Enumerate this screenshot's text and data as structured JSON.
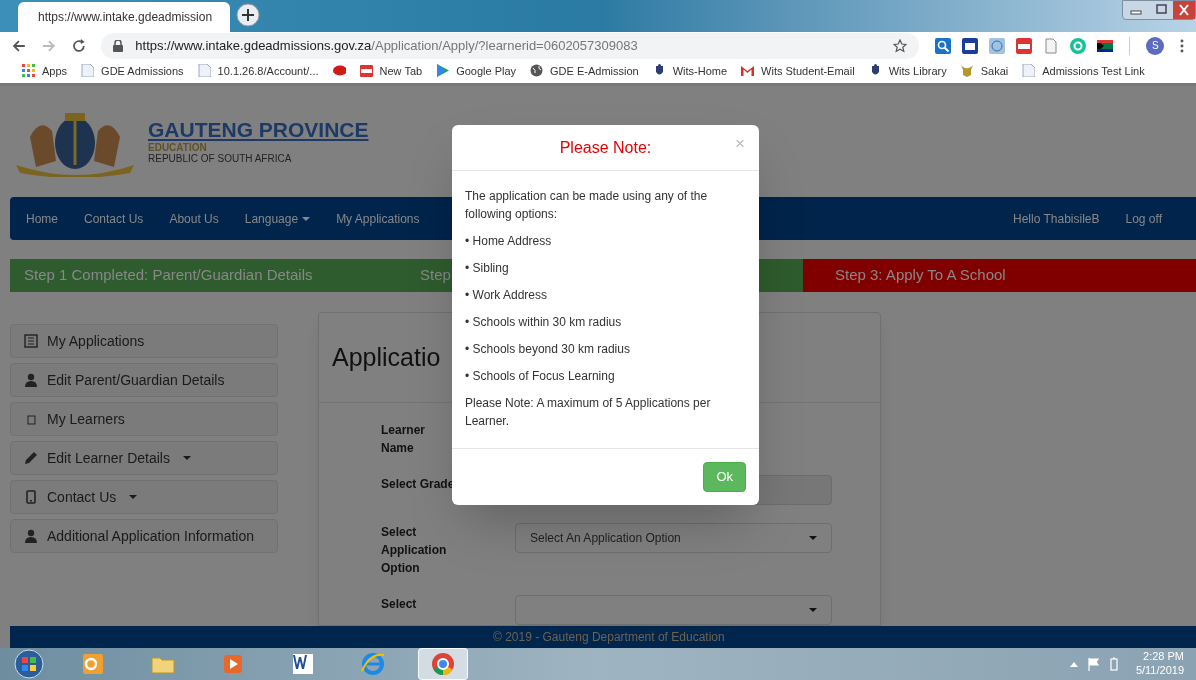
{
  "browser": {
    "tab": {
      "title": "https://www.intake.gdeadmission"
    },
    "url": {
      "host": "https://www.intake.gdeadmissions.gov.za",
      "path": "/Application/Apply/?learnerid=0602057309083"
    },
    "profile": "S",
    "bookmarks": [
      {
        "label": "Apps",
        "kind": "apps"
      },
      {
        "label": "GDE Admissions",
        "kind": "page"
      },
      {
        "label": "10.1.26.8/Account/...",
        "kind": "page"
      },
      {
        "kind": "ask"
      },
      {
        "label": "New Tab",
        "kind": "pdf"
      },
      {
        "label": "Google Play",
        "kind": "play"
      },
      {
        "label": "GDE E-Admission",
        "kind": "globe"
      },
      {
        "label": "Wits-Home",
        "kind": "crest"
      },
      {
        "label": "Wits Student-Email",
        "kind": "gmail"
      },
      {
        "label": "Wits Library",
        "kind": "crest"
      },
      {
        "label": "Sakai",
        "kind": "bull"
      },
      {
        "label": "Admissions Test Link",
        "kind": "page"
      }
    ]
  },
  "header": {
    "title": "GAUTENG PROVINCE",
    "subtitle": "EDUCATION",
    "country": "REPUBLIC OF SOUTH AFRICA"
  },
  "nav": {
    "items": [
      {
        "label": "Home",
        "dropdown": false
      },
      {
        "label": "Contact Us",
        "dropdown": false
      },
      {
        "label": "About Us",
        "dropdown": false
      },
      {
        "label": "Language",
        "dropdown": true
      },
      {
        "label": "My Applications",
        "dropdown": false
      }
    ],
    "right": [
      {
        "label": "Hello ThabisileB"
      },
      {
        "label": "Log off"
      }
    ]
  },
  "steps": [
    {
      "label": "Step 1 Completed: Parent/Guardian Details",
      "completed": true
    },
    {
      "label": "Step",
      "completed": true
    },
    {
      "label": "Step 3: Apply To A School",
      "completed": false
    }
  ],
  "sidebar": {
    "items": [
      {
        "label": "My Applications",
        "kind": "list",
        "dropdown": false
      },
      {
        "label": "Edit Parent/Guardian Details",
        "kind": "person",
        "dropdown": false
      },
      {
        "label": "My Learners",
        "kind": "square",
        "dropdown": false
      },
      {
        "label": "Edit Learner Details",
        "kind": "pencil",
        "dropdown": true
      },
      {
        "label": "Contact Us",
        "kind": "phone",
        "dropdown": true
      },
      {
        "label": "Additional Application Information",
        "kind": "person",
        "dropdown": false
      }
    ]
  },
  "panel": {
    "title": "Applicatio",
    "fields": [
      {
        "label": "Learner Name",
        "kind": "hidden"
      },
      {
        "label": "Select Grade",
        "kind": "readonly"
      },
      {
        "label": "Select Application Option",
        "kind": "select",
        "value": "Select An Application Option"
      },
      {
        "label": "Select",
        "kind": "select"
      }
    ]
  },
  "modal": {
    "title": "Please Note:",
    "close": "×",
    "intro": "The application can be made using any of the following options:",
    "options": [
      "• Home Address",
      "• Sibling",
      "• Work Address",
      "• Schools within 30 km radius",
      "• Schools beyond 30 km radius",
      "• Schools of Focus Learning"
    ],
    "note": "Please Note: A maximum of 5 Applications per Learner.",
    "button": "Ok"
  },
  "footer": "© 2019 - Gauteng Department of Education",
  "taskbar": {
    "apps": [
      {
        "kind": "outlook",
        "active": false
      },
      {
        "kind": "folder",
        "active": false
      },
      {
        "kind": "media",
        "active": false
      },
      {
        "kind": "word",
        "active": false
      },
      {
        "kind": "ie",
        "active": false
      },
      {
        "kind": "chrome",
        "active": true
      }
    ],
    "time": "2:28 PM",
    "date": "5/11/2019"
  }
}
